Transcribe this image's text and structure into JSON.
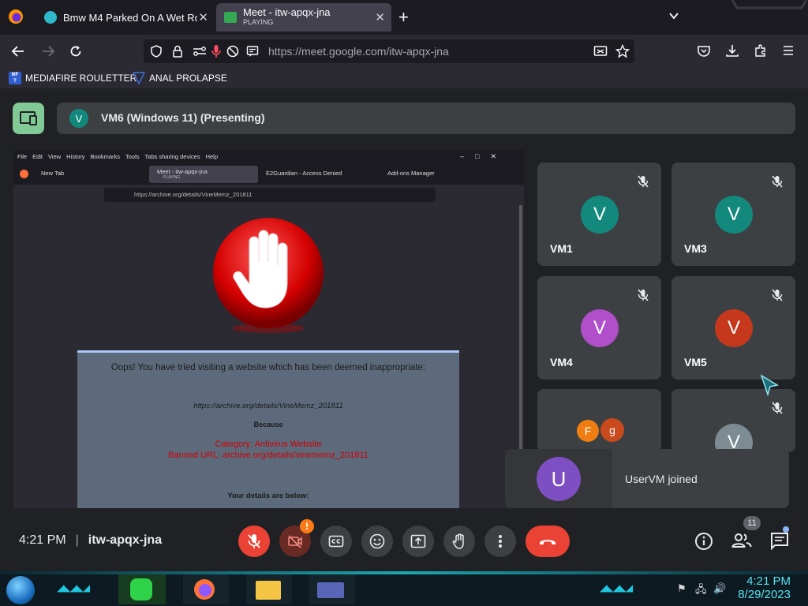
{
  "browser": {
    "tabs": [
      {
        "title": "Bmw M4 Parked On A Wet Roa",
        "subtitle": ""
      },
      {
        "title": "Meet - itw-apqx-jna",
        "subtitle": "PLAYING"
      }
    ],
    "new_tab": "+",
    "url": {
      "domain": "https://meet.google.com",
      "path": "/itw-apqx-jna"
    },
    "bookmarks": [
      "MEDIAFIRE ROULETTER",
      "ANAL PROLAPSE"
    ]
  },
  "meet": {
    "presenting": {
      "initial": "V",
      "label": "VM6 (Windows 11) (Presenting)"
    },
    "participants": [
      {
        "name": "VM1",
        "initial": "V",
        "color": "#12897c"
      },
      {
        "name": "VM3",
        "initial": "V",
        "color": "#12897c"
      },
      {
        "name": "VM4",
        "initial": "V",
        "color": "#b04fc9"
      },
      {
        "name": "VM5",
        "initial": "V",
        "color": "#c5381c"
      },
      {
        "name": "",
        "initial": "F",
        "color": "#f07d12",
        "initial2": "g",
        "color2": "#c94a1c"
      },
      {
        "name": "",
        "initial": "V",
        "color": "#7d8b93"
      }
    ],
    "toast": {
      "initial": "U",
      "color": "#7e4fc3",
      "text": "UserVM joined"
    },
    "bottom": {
      "time": "4:21 PM",
      "separator": "|",
      "meeting_code": "itw-apqx-jna",
      "people_count": "11",
      "camera_alert": "!"
    }
  },
  "shared_screen": {
    "menu": [
      "File",
      "Edit",
      "View",
      "History",
      "Bookmarks",
      "Tools",
      "Tabs sharing devices",
      "Help"
    ],
    "tabs": [
      "New Tab",
      "Meet - itw-apqx-jna",
      "E2Guardian - Access Denied",
      "Add-ons Manager"
    ],
    "tab_sub": "PLAYING",
    "url": "https://archive.org/details/VineMemz_201811",
    "message": "Oops! You have tried visiting a website which has been deemed inappropriate:",
    "blocked_url": "https://archive.org/details/VineMemz_201811",
    "because": "Because",
    "category": "Category: Antivirus Website",
    "banned_url": "Banned URL: archive.org/details/vinememz_201811",
    "details": "Your details are below:"
  },
  "taskbar": {
    "time": "4:21 PM",
    "date": "8/29/2023"
  },
  "colors": {
    "meet_bg": "#202124",
    "tile_bg": "#3c4043",
    "red": "#ea4335",
    "present_green": "#81c995",
    "clock_cyan": "#59e3ee"
  }
}
